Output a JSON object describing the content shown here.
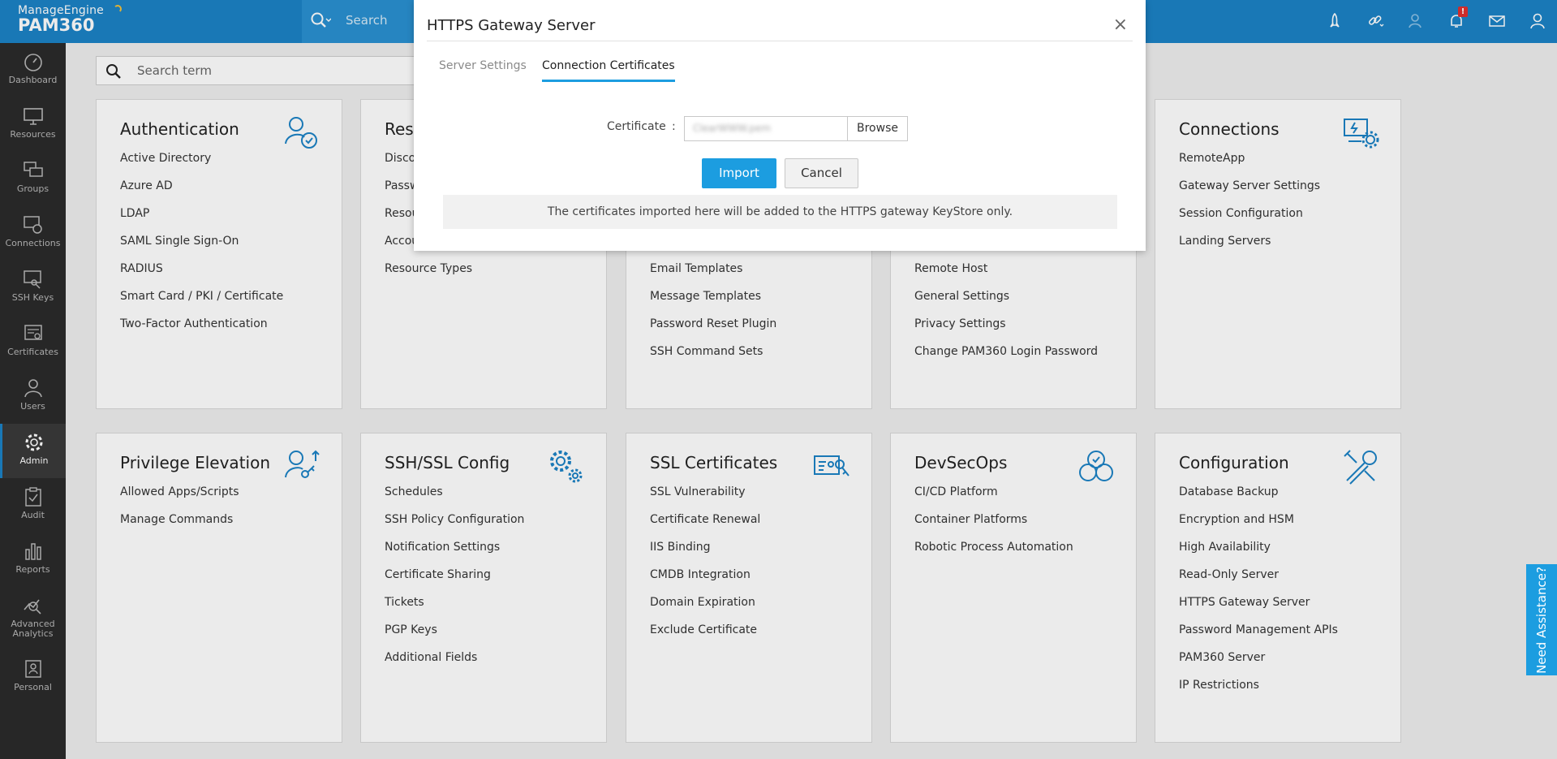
{
  "brand": {
    "company": "ManageEngine",
    "product": "PAM360"
  },
  "topbar": {
    "search_label": "Search",
    "notification_count": "!",
    "icons": [
      "rocket-icon",
      "link-key-icon",
      "user-pin-icon",
      "bell-icon",
      "mail-icon",
      "user-icon"
    ]
  },
  "sidebar": {
    "items": [
      {
        "label": "Dashboard",
        "icon": "dashboard-icon"
      },
      {
        "label": "Resources",
        "icon": "monitor-icon"
      },
      {
        "label": "Groups",
        "icon": "groups-icon"
      },
      {
        "label": "Connections",
        "icon": "connections-icon"
      },
      {
        "label": "SSH Keys",
        "icon": "ssh-key-icon"
      },
      {
        "label": "Certificates",
        "icon": "certificate-icon"
      },
      {
        "label": "Users",
        "icon": "users-icon"
      },
      {
        "label": "Admin",
        "icon": "gear-icon"
      },
      {
        "label": "Audit",
        "icon": "clipboard-icon"
      },
      {
        "label": "Reports",
        "icon": "bar-chart-icon"
      },
      {
        "label": "Advanced",
        "label2": "Analytics",
        "icon": "analytics-icon"
      },
      {
        "label": "Personal",
        "icon": "personal-icon"
      }
    ],
    "active": "Admin"
  },
  "admin_search": {
    "placeholder": "Search term"
  },
  "cards": {
    "authentication": {
      "title": "Authentication",
      "items": [
        "Active Directory",
        "Azure AD",
        "LDAP",
        "SAML Single Sign-On",
        "RADIUS",
        "Smart Card / PKI / Certificate",
        "Two-Factor Authentication"
      ]
    },
    "resource_config": {
      "title": "Res",
      "items": [
        "Disco",
        "Passw",
        "Resou",
        "Accou",
        "Resource Types"
      ]
    },
    "customization": {
      "items": [
        "Email Templates",
        "Message Templates",
        "Password Reset Plugin",
        "SSH Command Sets"
      ]
    },
    "settings": {
      "items": [
        "Remote Host",
        "General Settings",
        "Privacy Settings",
        "Change PAM360 Login Password"
      ]
    },
    "connections": {
      "title": "Connections",
      "items": [
        "RemoteApp",
        "Gateway Server Settings",
        "Session Configuration",
        "Landing Servers"
      ]
    },
    "privilege_elevation": {
      "title": "Privilege Elevation",
      "items": [
        "Allowed Apps/Scripts",
        "Manage Commands"
      ]
    },
    "ssh_ssl_config": {
      "title": "SSH/SSL Config",
      "items": [
        "Schedules",
        "SSH Policy Configuration",
        "Notification Settings",
        "Certificate Sharing",
        "Tickets",
        "PGP Keys",
        "Additional Fields"
      ]
    },
    "ssl_certificates": {
      "title": "SSL Certificates",
      "items": [
        "SSL Vulnerability",
        "Certificate Renewal",
        "IIS Binding",
        "CMDB Integration",
        "Domain Expiration",
        "Exclude Certificate"
      ]
    },
    "devsecops": {
      "title": "DevSecOps",
      "items": [
        "CI/CD Platform",
        "Container Platforms",
        "Robotic Process Automation"
      ]
    },
    "configuration": {
      "title": "Configuration",
      "items": [
        "Database Backup",
        "Encryption and HSM",
        "High Availability",
        "Read-Only Server",
        "HTTPS Gateway Server",
        "Password Management APIs",
        "PAM360 Server",
        "IP Restrictions"
      ]
    }
  },
  "modal": {
    "title": "HTTPS Gateway Server",
    "close": "×",
    "tabs": [
      {
        "label": "Server Settings",
        "active": false
      },
      {
        "label": "Connection Certificates",
        "active": true
      }
    ],
    "certificate_label": "Certificate",
    "colon": ":",
    "certificate_value": "ClearWWW.pem",
    "browse_label": "Browse",
    "import_label": "Import",
    "cancel_label": "Cancel",
    "info_text": "The certificates imported here will be added to the HTTPS gateway KeyStore only."
  },
  "assist": {
    "label": "Need Assistance?"
  },
  "colors": {
    "brand_blue": "#1c83c6",
    "accent_blue": "#1c9de0",
    "sidebar_bg": "#2b2b2b"
  }
}
